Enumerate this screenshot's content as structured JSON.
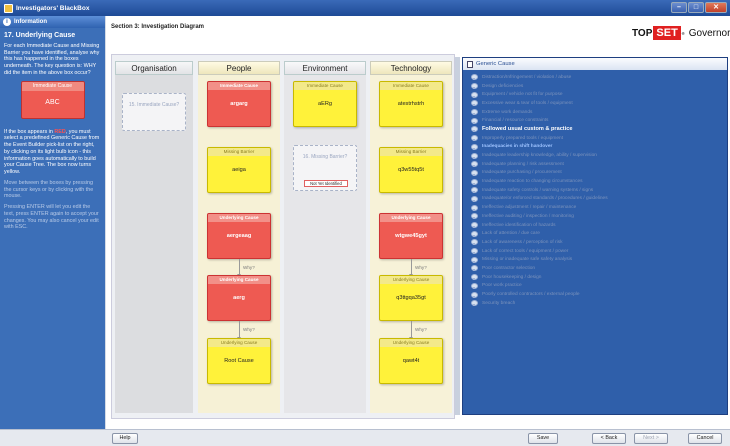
{
  "window": {
    "title": "Investigators' BlackBox"
  },
  "info_panel": {
    "header": "Information",
    "title": "17. Underlying Cause",
    "para1": "For each Immediate Cause and Missing Barrier you have identified, analyse why this has happened in the boxes underneath. The key question is: WHY did the item in the above box occur?",
    "sample_header": "Immediate Cause",
    "sample_value": "ABC",
    "para2_pre": "If the box appears in ",
    "para2_red": "RED",
    "para2_post": ", you must select a predefined Generic Cause from the Event Builder pick-list on the right, by clicking on its light bulb icon - this information goes automatically to build your Cause Tree. The box now turns yellow.",
    "para3": "Move between the boxes by pressing the cursor keys or by clicking with the mouse.",
    "para4": "Pressing ENTER will let you edit the text, press ENTER again to accept your changes. You may also cancel your edit with ESC."
  },
  "section_title": "Section 3: Investigation Diagram",
  "brand": {
    "pre": "TOP",
    "set": "SET",
    "post": "Governor"
  },
  "columns": {
    "organisation": "Organisation",
    "people": "People",
    "environment": "Environment",
    "technology": "Technology"
  },
  "cards": {
    "org_immediate_placeholder": "15. Immediate Cause?",
    "ppl_immediate": {
      "header": "Immediate Cause",
      "value": "argarg"
    },
    "ppl_missing": {
      "header": "Missing Barrier",
      "value": "aeiga"
    },
    "ppl_underlying1": {
      "header": "Underlying Cause",
      "value": "aergeaag"
    },
    "ppl_underlying2": {
      "header": "Underlying Cause",
      "value": "aerg"
    },
    "ppl_underlying3": {
      "header": "Underlying Cause",
      "value": "Root Cause"
    },
    "env_immediate": {
      "header": "Immediate Cause",
      "value": "aERg"
    },
    "env_missing_placeholder": "16. Missing Barrier?",
    "env_not_identified": "Not Yet Identified",
    "tech_immediate": {
      "header": "Immediate Cause",
      "value": "atestrhstrh"
    },
    "tech_missing": {
      "header": "Missing Barrier",
      "value": "q3w55tq5t"
    },
    "tech_underlying1": {
      "header": "Underlying Cause",
      "value": "wtgwe45gyt"
    },
    "tech_underlying2": {
      "header": "Underlying Cause",
      "value": "q3ttgqa35gt"
    },
    "tech_underlying3": {
      "header": "Underlying Cause",
      "value": "qawt4t"
    }
  },
  "why_label": "Why?",
  "generic_cause": {
    "header": "Generic Cause",
    "items": [
      "Distraction/Infringement / violation / abuse",
      "Design deficiencies",
      "Equipment / vehicle not fit for purpose",
      "Excessive wear & tear of tools / equipment",
      "Extreme work demands",
      "Financial / resource constraints",
      "Followed usual custom & practice",
      "Improperly prepared tools / equipment",
      "Inadequacies in shift handover",
      "Inadequate leadership knowledge, ability / supervision",
      "Inadequate planning / risk assessment",
      "Inadequate purchasing / procurement",
      "Inadequate reaction to changing circumstances",
      "Inadequate safety controls / warning systems / signs",
      "Inadequate/or enforced standards / procedures / guidelines",
      "Ineffective adjustment / repair / maintenance",
      "Ineffective auditing / inspection / monitoring",
      "Ineffective identification of hazards",
      "Lack of attention / due care",
      "Lack of awareness / perception of risk",
      "Lack of correct tools / equipment / power",
      "Missing or inadequate safe safety analysis",
      "Poor contractor selection",
      "Poor housekeeping / design",
      "Poor work practice",
      "Poorly controlled contractors / external people",
      "Security breach"
    ],
    "selected_index": 6,
    "highlight_indices": [
      8
    ]
  },
  "footer": {
    "help": "Help",
    "save": "Save",
    "back": "< Back",
    "next": "Next >",
    "cancel": "Cancel"
  }
}
